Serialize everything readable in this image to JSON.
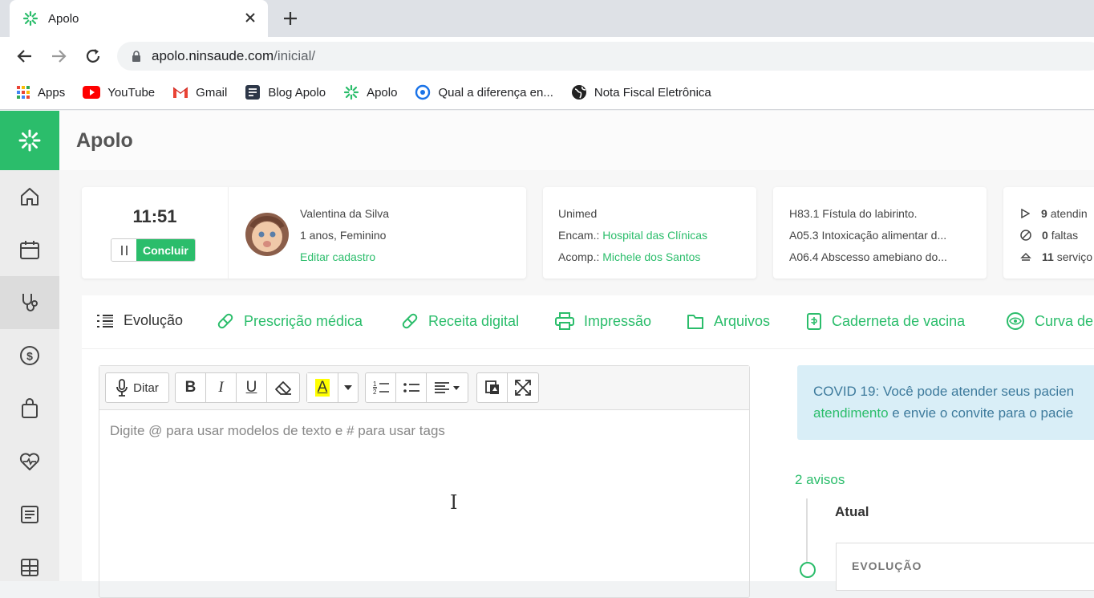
{
  "browser": {
    "tab_title": "Apolo",
    "url_host": "apolo.ninsaude.com",
    "url_path": "/inicial/",
    "bookmarks": [
      {
        "label": "Apps",
        "icon": "apps-grid-icon"
      },
      {
        "label": "YouTube",
        "icon": "youtube-icon"
      },
      {
        "label": "Gmail",
        "icon": "gmail-icon"
      },
      {
        "label": "Blog Apolo",
        "icon": "blog-icon"
      },
      {
        "label": "Apolo",
        "icon": "apolo-icon"
      },
      {
        "label": "Qual a diferença en...",
        "icon": "circle-target-icon"
      },
      {
        "label": "Nota Fiscal Eletrônica",
        "icon": "globe-icon"
      }
    ]
  },
  "app": {
    "name": "Apolo"
  },
  "timer": {
    "time": "11:51",
    "finish_label": "Concluir"
  },
  "patient": {
    "name": "Valentina da Silva",
    "info": "1 anos, Feminino",
    "edit_label": "Editar cadastro"
  },
  "insurance": {
    "name": "Unimed",
    "encam_label": "Encam.:",
    "encam_value": "Hospital das Clínicas",
    "acomp_label": "Acomp.:",
    "acomp_value": "Michele dos Santos"
  },
  "diagnoses": [
    "H83.1 Fístula do labirinto.",
    "A05.3 Intoxicação alimentar d...",
    "A06.4 Abscesso amebiano do..."
  ],
  "stats": [
    {
      "value": "9",
      "label": "atendin"
    },
    {
      "value": "0",
      "label": "faltas"
    },
    {
      "value": "11",
      "label": "serviço"
    }
  ],
  "tabs": [
    {
      "label": "Evolução",
      "icon": "list-icon"
    },
    {
      "label": "Prescrição médica",
      "icon": "pill-icon"
    },
    {
      "label": "Receita digital",
      "icon": "pill-icon"
    },
    {
      "label": "Impressão",
      "icon": "printer-icon"
    },
    {
      "label": "Arquivos",
      "icon": "folder-icon"
    },
    {
      "label": "Caderneta de vacina",
      "icon": "vaccine-icon"
    },
    {
      "label": "Curva de",
      "icon": "eye-icon"
    }
  ],
  "editor": {
    "dictate_label": "Ditar",
    "placeholder": "Digite @ para usar modelos de texto e # para usar tags",
    "bold": "B",
    "italic": "I",
    "underline": "U",
    "highlight": "A",
    "highlight_color": "#ffff00"
  },
  "notice": {
    "line1": "COVID 19: Você pode atender seus pacien",
    "link": "atendimento",
    "line2_rest": " e envie o convite para o pacie"
  },
  "timeline": {
    "count_label": "2 avisos",
    "current_label": "Atual",
    "entry_label": "EVOLUÇÃO"
  },
  "colors": {
    "brand": "#2bbd6b",
    "notice_bg": "#d9eef7"
  }
}
